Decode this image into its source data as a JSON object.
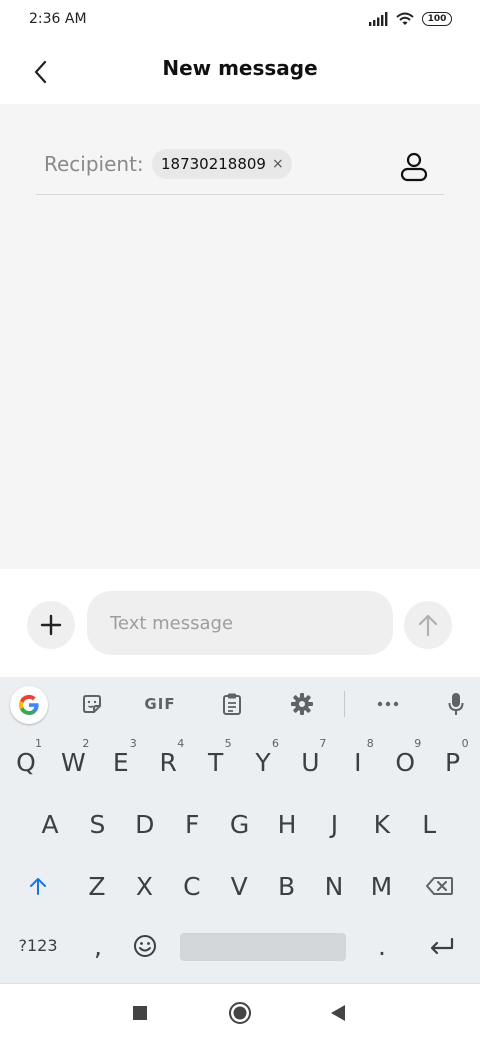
{
  "status": {
    "time": "2:36 AM",
    "battery": "100"
  },
  "header": {
    "title": "New message"
  },
  "recipient": {
    "label": "Recipient:",
    "chip_number": "18730218809",
    "chip_close": "×"
  },
  "compose": {
    "placeholder": "Text message"
  },
  "keyboard": {
    "gif_label": "GIF",
    "rows": [
      [
        {
          "k": "Q",
          "n": "1"
        },
        {
          "k": "W",
          "n": "2"
        },
        {
          "k": "E",
          "n": "3"
        },
        {
          "k": "R",
          "n": "4"
        },
        {
          "k": "T",
          "n": "5"
        },
        {
          "k": "Y",
          "n": "6"
        },
        {
          "k": "U",
          "n": "7"
        },
        {
          "k": "I",
          "n": "8"
        },
        {
          "k": "O",
          "n": "9"
        },
        {
          "k": "P",
          "n": "0"
        }
      ],
      [
        {
          "k": "A"
        },
        {
          "k": "S"
        },
        {
          "k": "D"
        },
        {
          "k": "F"
        },
        {
          "k": "G"
        },
        {
          "k": "H"
        },
        {
          "k": "J"
        },
        {
          "k": "K"
        },
        {
          "k": "L"
        }
      ],
      [
        {
          "k": "Z"
        },
        {
          "k": "X"
        },
        {
          "k": "C"
        },
        {
          "k": "V"
        },
        {
          "k": "B"
        },
        {
          "k": "N"
        },
        {
          "k": "M"
        }
      ]
    ],
    "symbols_label": "?123",
    "comma_label": ",",
    "period_label": "."
  },
  "colors": {
    "shift_accent": "#1a73e8",
    "content_bg": "#f5f5f5",
    "keyboard_bg": "#eceff1"
  },
  "icons": [
    "back-arrow-icon",
    "contact-icon",
    "plus-icon",
    "send-arrow-icon",
    "google-icon",
    "sticker-icon",
    "clipboard-icon",
    "gear-icon",
    "more-icon",
    "mic-icon",
    "shift-icon",
    "backspace-icon",
    "emoji-icon",
    "enter-icon",
    "square-icon",
    "circle-icon",
    "triangle-icon"
  ]
}
